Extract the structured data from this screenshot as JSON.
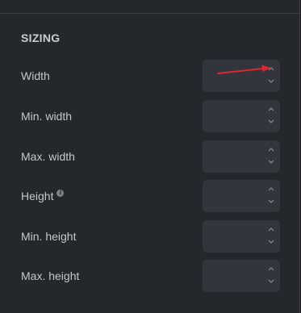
{
  "section": {
    "title": "SIZING"
  },
  "fields": [
    {
      "label": "Width",
      "value": "",
      "has_info": false
    },
    {
      "label": "Min. width",
      "value": "",
      "has_info": false
    },
    {
      "label": "Max. width",
      "value": "",
      "has_info": false
    },
    {
      "label": "Height",
      "value": "",
      "has_info": true
    },
    {
      "label": "Min. height",
      "value": "",
      "has_info": false
    },
    {
      "label": "Max. height",
      "value": "",
      "has_info": false
    }
  ],
  "icons": {
    "info": "info-icon",
    "increment": "chevron-up-icon",
    "decrement": "chevron-down-icon",
    "annotation": "red-arrow-annotation"
  },
  "colors": {
    "annotation_arrow": "#e0262c",
    "panel_background": "#24272b",
    "field_background": "#32363c"
  }
}
